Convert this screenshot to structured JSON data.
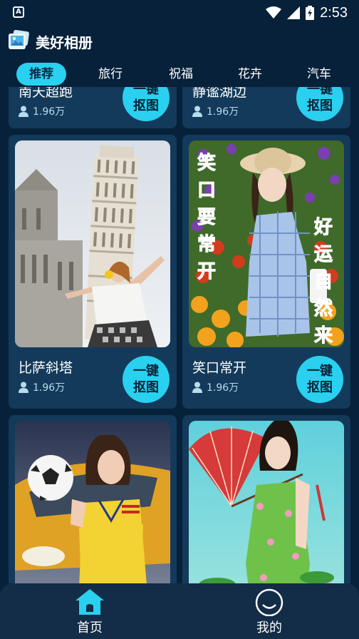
{
  "status_bar": {
    "time": "2:53",
    "notification_icon": "a-icon"
  },
  "app": {
    "title": "美好相册",
    "logo_icon": "photo-album-icon"
  },
  "tabs": [
    {
      "label": "推荐",
      "active": true
    },
    {
      "label": "旅行",
      "active": false
    },
    {
      "label": "祝福",
      "active": false
    },
    {
      "label": "花卉",
      "active": false
    },
    {
      "label": "汽车",
      "active": false
    }
  ],
  "cards": [
    {
      "title": "南天超跑",
      "views": "1.96万",
      "button_line1": "一键",
      "button_line2": "抠图"
    },
    {
      "title": "静谧湖边",
      "views": "1.96万",
      "button_line1": "一键",
      "button_line2": "抠图"
    },
    {
      "title": "比萨斜塔",
      "views": "1.96万",
      "button_line1": "一键",
      "button_line2": "抠图"
    },
    {
      "title": "笑口常开",
      "views": "1.96万",
      "button_line1": "一键",
      "button_line2": "抠图",
      "poster_left": "笑口要常开",
      "poster_right": "好运自然来"
    },
    {
      "title": "",
      "views": "",
      "button_line1": "",
      "button_line2": ""
    },
    {
      "title": "",
      "views": "",
      "button_line1": "",
      "button_line2": ""
    }
  ],
  "bottom_nav": [
    {
      "label": "首页",
      "icon": "home-icon",
      "active": true
    },
    {
      "label": "我的",
      "icon": "smiley-icon",
      "active": false
    }
  ],
  "colors": {
    "background": "#07213a",
    "card": "#133a5a",
    "accent": "#2ad0ef",
    "nav": "#132c47"
  }
}
